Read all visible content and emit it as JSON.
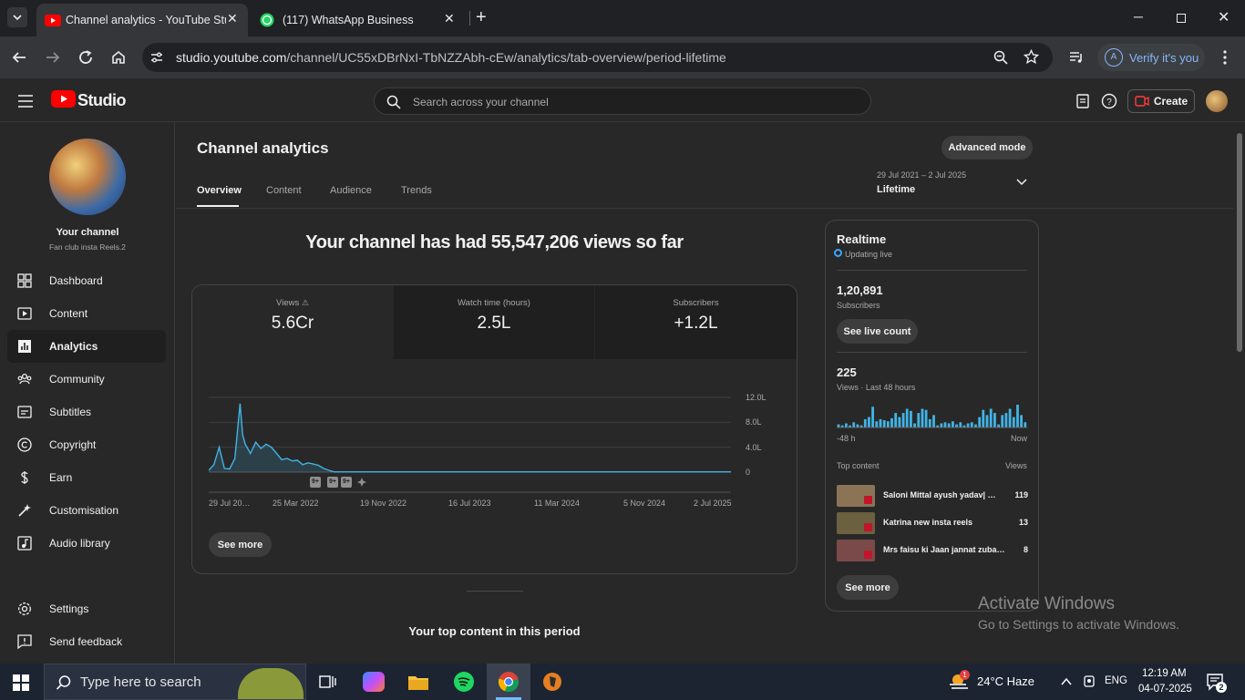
{
  "browser": {
    "tabs": [
      {
        "label": "Channel analytics - YouTube Stu",
        "active": true
      },
      {
        "label": "(117) WhatsApp Business",
        "active": false
      }
    ],
    "new_tab_symbol": "+",
    "url_host": "studio.youtube.com",
    "url_path": "/channel/UC55xDBrNxI-TbNZZAbh-cEw/analytics/tab-overview/period-lifetime",
    "verify_label": "Verify it's you",
    "profile_initial": "A"
  },
  "studio": {
    "logo_text": "Studio",
    "search_placeholder": "Search across your channel",
    "create_label": "Create"
  },
  "sidebar": {
    "channel_title": "Your channel",
    "channel_name": "Fan club insta Reels.2",
    "items": [
      {
        "label": "Dashboard",
        "icon": "dashboard-icon"
      },
      {
        "label": "Content",
        "icon": "content-icon"
      },
      {
        "label": "Analytics",
        "icon": "analytics-icon",
        "active": true
      },
      {
        "label": "Community",
        "icon": "community-icon"
      },
      {
        "label": "Subtitles",
        "icon": "subtitles-icon"
      },
      {
        "label": "Copyright",
        "icon": "copyright-icon"
      },
      {
        "label": "Earn",
        "icon": "earn-icon"
      },
      {
        "label": "Customisation",
        "icon": "customisation-icon"
      },
      {
        "label": "Audio library",
        "icon": "audio-library-icon"
      }
    ],
    "settings_label": "Settings",
    "feedback_label": "Send feedback"
  },
  "analytics": {
    "page_title": "Channel analytics",
    "advanced_mode_label": "Advanced mode",
    "tabs": [
      "Overview",
      "Content",
      "Audience",
      "Trends"
    ],
    "date_range": "29 Jul 2021 – 2 Jul 2025",
    "period_label": "Lifetime",
    "headline": "Your channel has had 55,547,206 views so far",
    "metrics": [
      {
        "label": "Views",
        "value": "5.6Cr"
      },
      {
        "label": "Watch time (hours)",
        "value": "2.5L"
      },
      {
        "label": "Subscribers",
        "value": "+1.2L"
      }
    ],
    "see_more_label": "See more",
    "top_content_heading": "Your top content in this period"
  },
  "chart_data": {
    "type": "line",
    "x_tick_labels": [
      "29 Jul 20…",
      "25 Mar 2022",
      "19 Nov 2022",
      "16 Jul 2023",
      "11 Mar 2024",
      "5 Nov 2024",
      "2 Jul 2025"
    ],
    "y_tick_labels": [
      "12.0L",
      "8.0L",
      "4.0L",
      "0"
    ],
    "ylim": [
      0,
      1200000
    ],
    "grid": true,
    "x": [
      0,
      0.01,
      0.02,
      0.03,
      0.04,
      0.05,
      0.06,
      0.065,
      0.07,
      0.08,
      0.09,
      0.1,
      0.11,
      0.12,
      0.13,
      0.14,
      0.15,
      0.16,
      0.17,
      0.18,
      0.19,
      0.2,
      0.21,
      0.22,
      0.23,
      0.24,
      1.0
    ],
    "values": [
      30000,
      120000,
      400000,
      60000,
      50000,
      220000,
      1100000,
      600000,
      450000,
      300000,
      480000,
      380000,
      450000,
      400000,
      300000,
      200000,
      220000,
      180000,
      190000,
      120000,
      150000,
      130000,
      110000,
      60000,
      30000,
      5000,
      5000
    ],
    "annotation_markers": [
      "9+",
      "9+",
      "9+",
      "spark"
    ]
  },
  "realtime": {
    "title": "Realtime",
    "status": "Updating live",
    "subscribers_value": "1,20,891",
    "subscribers_label": "Subscribers",
    "see_live_label": "See live count",
    "views_value": "225",
    "views_label": "Views · Last 48 hours",
    "bars_48h": [
      3,
      2,
      4,
      2,
      5,
      3,
      2,
      8,
      10,
      20,
      6,
      8,
      7,
      6,
      9,
      14,
      10,
      14,
      18,
      16,
      4,
      14,
      18,
      17,
      8,
      12,
      2,
      4,
      5,
      4,
      6,
      3,
      5,
      2,
      4,
      5,
      3,
      10,
      17,
      12,
      18,
      14,
      3,
      12,
      14,
      18,
      10,
      22,
      12,
      5
    ],
    "axis_start": "-48 h",
    "axis_end": "Now",
    "top_content_label": "Top content",
    "views_column_label": "Views",
    "top_content": [
      {
        "title": "Saloni Mittal ayush yadav| …",
        "views": "119",
        "thumb_color": "#8b7355"
      },
      {
        "title": "Katrina new insta reels",
        "views": "13",
        "thumb_color": "#6b6040"
      },
      {
        "title": "Mrs faisu ki Jaan jannat zuba…",
        "views": "8",
        "thumb_color": "#7a4a4a"
      }
    ],
    "see_more_label": "See more"
  },
  "watermark": {
    "line1": "Activate Windows",
    "line2": "Go to Settings to activate Windows."
  },
  "taskbar": {
    "search_placeholder": "Type here to search",
    "weather": "24°C  Haze",
    "weather_badge": "1",
    "language": "ENG",
    "time": "12:19 AM",
    "date": "04-07-2025",
    "notifications": "2"
  },
  "colors": {
    "accent": "#3ea6ff",
    "youtube_red": "#ff0000",
    "chart_line": "#41b4e6"
  }
}
